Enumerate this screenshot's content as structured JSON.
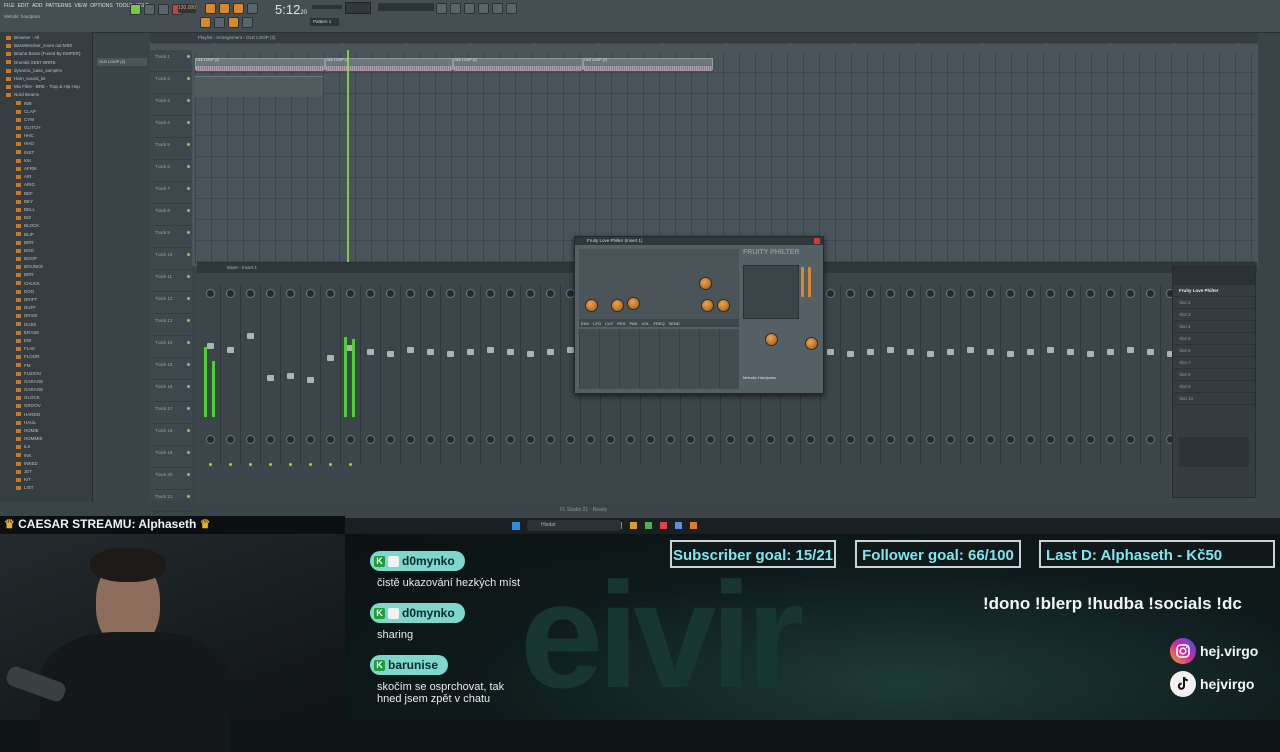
{
  "fl": {
    "menus": [
      "FILE",
      "EDIT",
      "ADD",
      "PATTERNS",
      "VIEW",
      "OPTIONS",
      "TOOLS",
      "HELP"
    ],
    "tempo": "130.000",
    "time": "5:12",
    "time_sub": "20",
    "pattern": "Pattern 1",
    "project_hint": "Melodic handpass",
    "playlist_title": "Playlist - Arrangement › OLE LOOP (2)",
    "browser_items": [
      "Browser - All",
      "BassWrecker_zoom out MIDI",
      "Brama Beats (Fused By EMPER)",
      "Drumkit XE57 BRRS",
      "dynamic_bass_samples",
      "Harn_sound_kit",
      "Mix Files - BRE - Trap & Hip Hop",
      "Nord Beams",
      "808",
      "CLAP",
      "CYM",
      "GLITCH",
      "HHC",
      "HHO",
      "INST",
      "KIK",
      "AFRIK",
      "AIR",
      "ARIG",
      "BEF",
      "BEY",
      "BELL",
      "BIZ",
      "BLOCK",
      "BLIP",
      "BRR",
      "BOD",
      "BOOP",
      "BOUNCE",
      "BRR",
      "CHUCK",
      "DOO",
      "DRIFT",
      "DUFF",
      "DRISK",
      "DUSK",
      "ERASE",
      "EW",
      "FLAK",
      "FLOOR",
      "FM",
      "FUZION",
      "GARAGE",
      "GARAGE",
      "GLOCK",
      "GROOV",
      "HARDO",
      "HAUL",
      "HOMIE",
      "HOMMIE",
      "ILK",
      "INK",
      "INKED",
      "JET",
      "KIT",
      "LIST"
    ],
    "tracks": [
      "Track 1",
      "Track 2",
      "Track 3",
      "Track 4",
      "Track 5",
      "Track 6",
      "Track 7",
      "Track 8",
      "Track 9",
      "Track 10",
      "Track 11",
      "Track 12",
      "Track 13",
      "Track 14",
      "Track 15",
      "Track 16",
      "Track 17",
      "Track 18",
      "Track 19",
      "Track 20",
      "Track 21"
    ],
    "clips": [
      "OLE LOOP (2)",
      "OLE LOOP (2)",
      "OLE LOOP (2)",
      "OLE LOOP (2)"
    ],
    "mixer_title": "Mixer - Insert 1",
    "fx_slots": [
      "Fruity Love Philter",
      "Slot 2",
      "Slot 3",
      "Slot 4",
      "Slot 5",
      "Slot 6",
      "Slot 7",
      "Slot 8",
      "Slot 9",
      "Slot 10"
    ],
    "plugin": {
      "title": "Fruity Love Philter (Insert 1)",
      "brand": "FRUITY PHILTER",
      "preset": "Melodic handpass",
      "tabs": [
        "ENV",
        "LFO",
        "CUT",
        "RES",
        "PAN",
        "VOL",
        "FREQ",
        "SEND"
      ],
      "footer": "Melodic Handpass"
    },
    "taskbar_search": "Hledat",
    "status_line": "FL Studio 21 · Ready"
  },
  "overlay": {
    "caesar": "CAESAR STREAMU: Alphaseth",
    "chat": [
      {
        "user": "d0mynko",
        "message": "čistě ukazování hezkých míst"
      },
      {
        "user": "d0mynko",
        "message": "sharing"
      },
      {
        "user": "barunise",
        "message": "skočím se osprchovat, tak hned jsem zpět v chatu"
      }
    ],
    "goals": {
      "subscriber": "Subscriber goal: 15/21",
      "follower": "Follower goal: 66/100",
      "last_donation": "Last D: Alphaseth - Kč50"
    },
    "commands": "!dono !blerp !hudba !socials !dc",
    "socials": [
      {
        "icon": "instagram-icon",
        "handle": "hej.virgo"
      },
      {
        "icon": "tiktok-icon",
        "handle": "hejvirgo"
      }
    ],
    "accent_color": "#7fd7cc",
    "goal_text_color": "#7ee8ef"
  }
}
